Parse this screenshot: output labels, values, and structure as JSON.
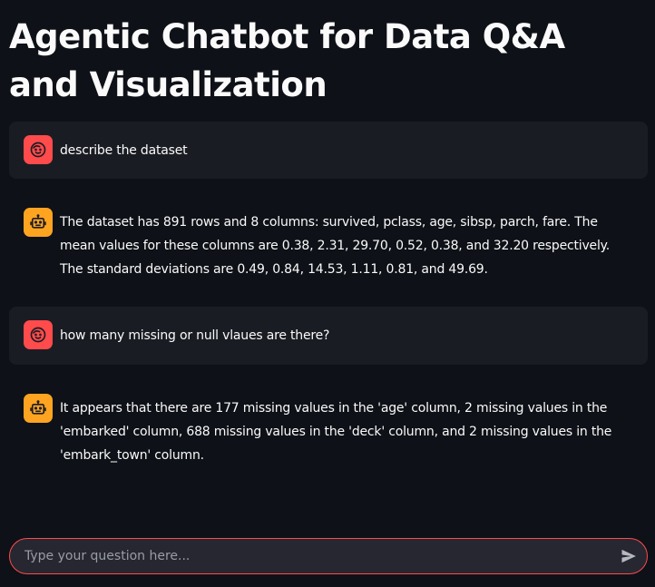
{
  "page": {
    "title": "Agentic Chatbot for Data Q&A and Visualization"
  },
  "chat": {
    "messages": [
      {
        "role": "user",
        "avatar_icon": "user-face-icon",
        "text": "describe the dataset"
      },
      {
        "role": "assistant",
        "avatar_icon": "robot-icon",
        "text": "The dataset has 891 rows and 8 columns: survived, pclass, age, sibsp, parch, fare. The mean values for these columns are 0.38, 2.31, 29.70, 0.52, 0.38, and 32.20 respectively. The standard deviations are 0.49, 0.84, 14.53, 1.11, 0.81, and 49.69."
      },
      {
        "role": "user",
        "avatar_icon": "user-face-icon",
        "text": "how many missing or null vlaues are there?"
      },
      {
        "role": "assistant",
        "avatar_icon": "robot-icon",
        "text": "It appears that there are 177 missing values in the 'age' column, 2 missing values in the 'embarked' column, 688 missing values in the 'deck' column, and 2 missing values in the 'embark_town' column."
      }
    ]
  },
  "input": {
    "placeholder": "Type your question here...",
    "value": "",
    "send_icon": "send-icon"
  },
  "colors": {
    "background": "#0e1117",
    "user_bubble": "#1a1c24",
    "user_avatar": "#ff4b4b",
    "assistant_avatar": "#ffa421",
    "input_border": "#ff4b4b",
    "input_background": "#262730"
  }
}
